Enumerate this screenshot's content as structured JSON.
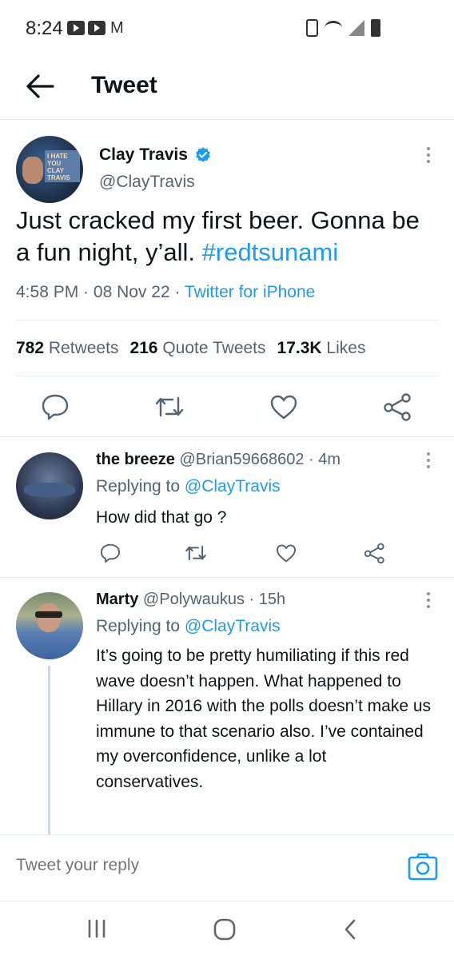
{
  "status_bar": {
    "time": "8:24",
    "mail_glyph": "M"
  },
  "header": {
    "title": "Tweet"
  },
  "tweet": {
    "name": "Clay Travis",
    "handle": "@ClayTravis",
    "avatar_sign_text": "I HATE YOU CLAY TRAVIS",
    "text": "Just cracked my first beer. Gonna be a fun night, y’all. ",
    "hashtag": "#redtsunami",
    "time": "4:58 PM",
    "sep1": " · ",
    "date": "08 Nov 22",
    "sep2": " · ",
    "source": "Twitter for iPhone",
    "retweets_count": "782",
    "retweets_label": "Retweets",
    "quotes_count": "216",
    "quotes_label": "Quote Tweets",
    "likes_count": "17.3K",
    "likes_label": "Likes"
  },
  "replies": [
    {
      "name": "the breeze",
      "handle": "@Brian59668602",
      "time": " · 4m",
      "replying_prefix": "Replying to ",
      "replying_to": "@ClayTravis",
      "text": "How did that go ?"
    },
    {
      "name": "Marty",
      "handle": "@Polywaukus",
      "time": " · 15h",
      "replying_prefix": "Replying to ",
      "replying_to": "@ClayTravis",
      "text": "It’s going to be pretty humiliating if this red wave doesn’t happen. What happened to Hillary in 2016 with the polls doesn’t make us immune to that scenario also. I’ve contained my overconfidence, unlike a lot conservatives."
    }
  ],
  "compose": {
    "placeholder": "Tweet your reply"
  },
  "colors": {
    "accent": "#1d9bf0",
    "secondary_text": "#536471",
    "icon_gray": "#536471"
  },
  "icons": [
    "back-arrow-icon",
    "verified-badge-icon",
    "more-options-icon",
    "reply-icon",
    "retweet-icon",
    "like-icon",
    "share-icon",
    "camera-icon",
    "recent-apps-icon",
    "home-icon",
    "back-icon"
  ]
}
